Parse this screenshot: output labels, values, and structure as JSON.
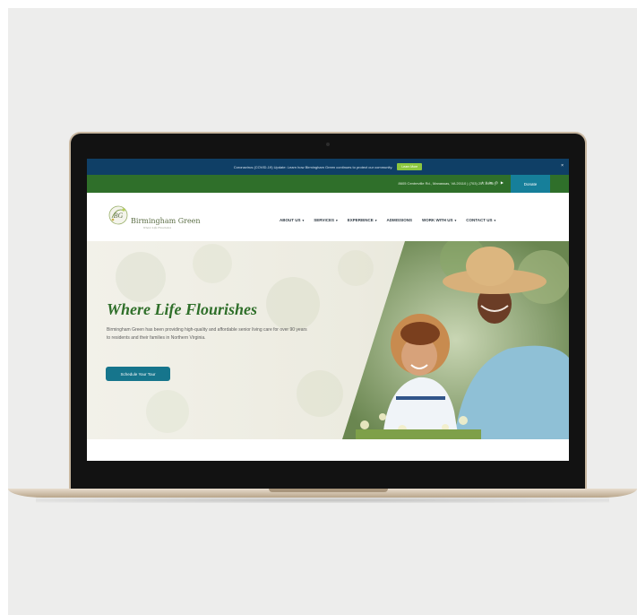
{
  "announcement": {
    "text": "Coronavirus (COVID-19) Update: Learn how Birmingham Green continues to protect our community.",
    "button_label": "Learn More",
    "close_label": "×"
  },
  "contact_bar": {
    "address_phone": "8605 Centreville Rd., Manassas, VA 20110 | (703) 257-0935 |",
    "social_icons": [
      "twitter-icon",
      "facebook-icon",
      "linkedin-icon",
      "instagram-icon",
      "youtube-icon"
    ],
    "donate_label": "Donate"
  },
  "logo": {
    "monogram": "BG",
    "name": "Birmingham Green",
    "tagline": "Where Life Flourishes"
  },
  "nav": {
    "items": [
      {
        "label": "ABOUT US",
        "dropdown": "▾"
      },
      {
        "label": "SERVICES",
        "dropdown": "▾"
      },
      {
        "label": "EXPERIENCE",
        "dropdown": "▾"
      },
      {
        "label": "ADMISSIONS",
        "dropdown": ""
      },
      {
        "label": "WORK WITH US",
        "dropdown": "▾"
      },
      {
        "label": "CONTACT US",
        "dropdown": "▾"
      }
    ]
  },
  "hero": {
    "title": "Where Life Flourishes",
    "subtitle": "Birmingham Green has been providing high-quality and affordable senior living care for over 90 years to residents and their families in Northern Virginia.",
    "cta_label": "Schedule Your Tour"
  },
  "colors": {
    "announcement_bg": "#0f3f66",
    "contact_bar_bg": "#2f6f2a",
    "donate_bg": "#167f9a",
    "cta_bg": "#16758c",
    "title_green": "#2f6f2a"
  }
}
